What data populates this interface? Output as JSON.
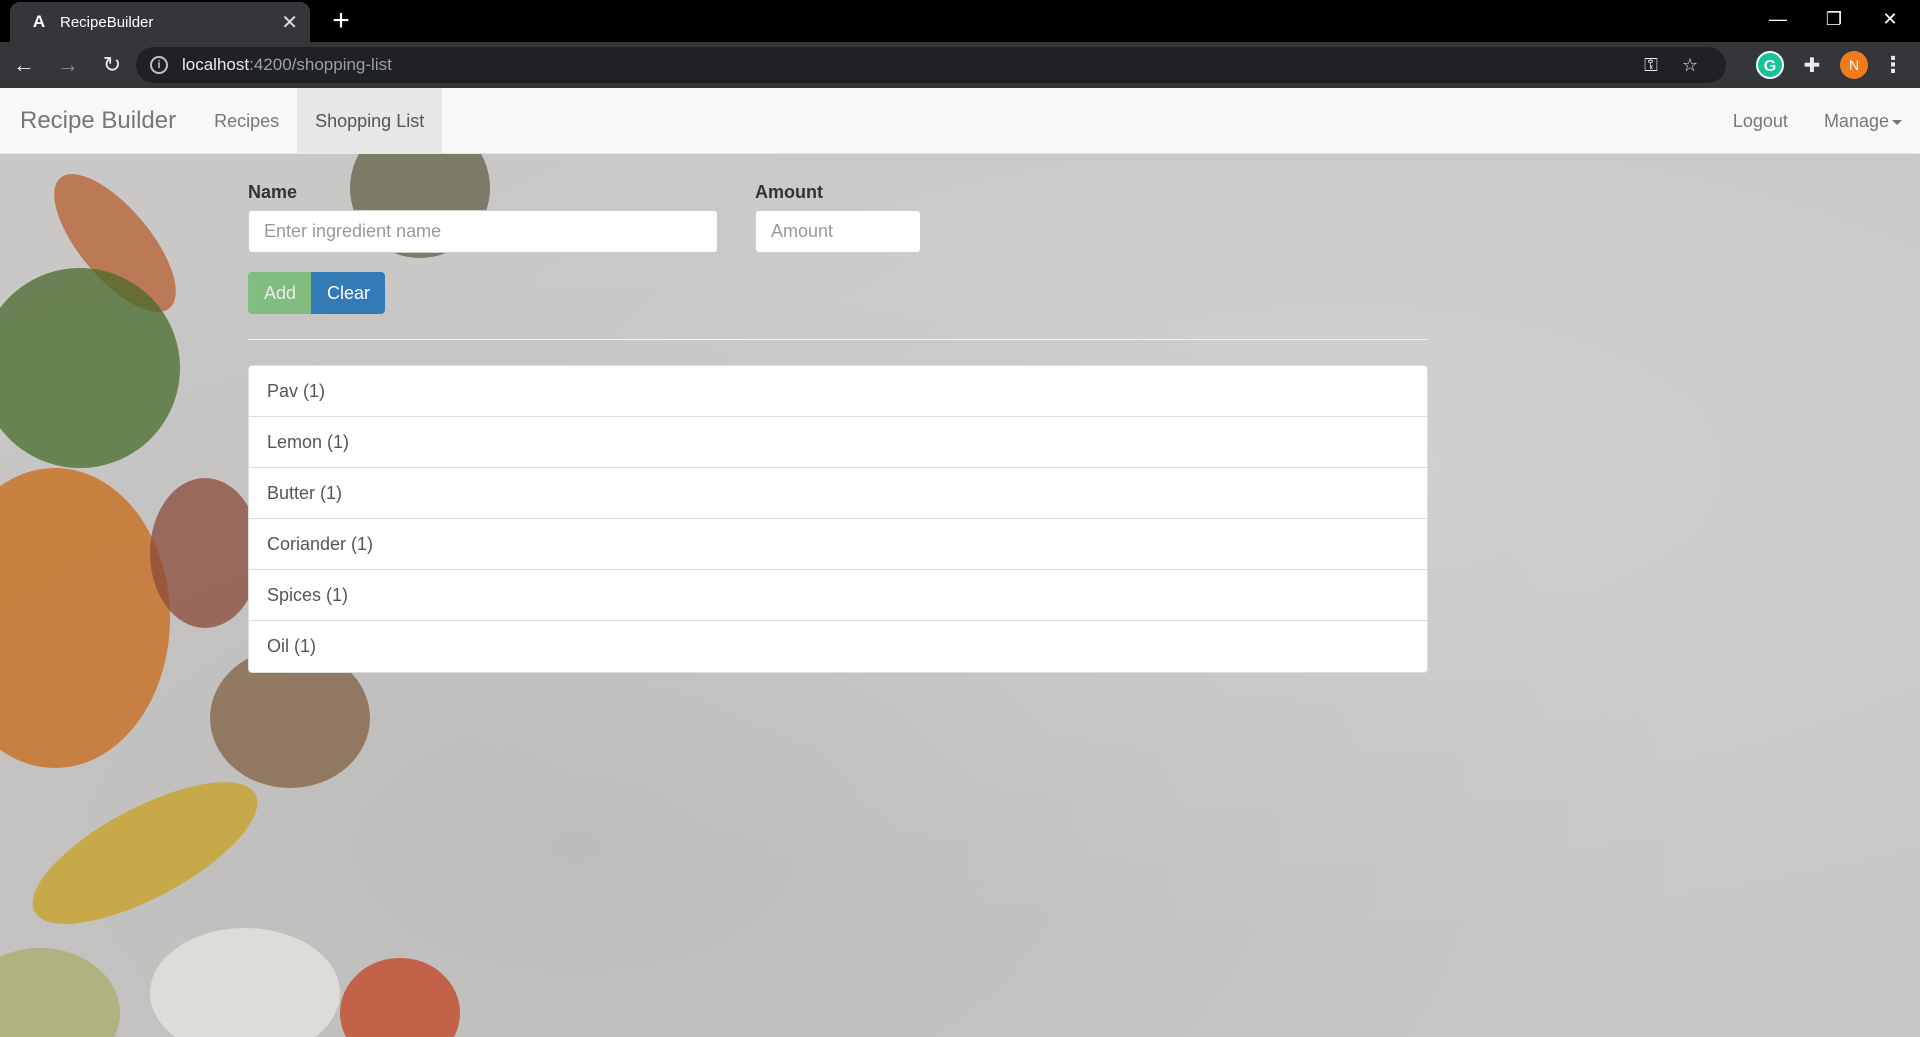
{
  "browser": {
    "tab_title": "RecipeBuilder",
    "favicon": "A",
    "url_host": "localhost",
    "url_path": ":4200/shopping-list",
    "avatar_letter": "N",
    "extension_letter": "G"
  },
  "navbar": {
    "brand": "Recipe Builder",
    "links": [
      "Recipes",
      "Shopping List"
    ],
    "active": "Shopping List",
    "logout": "Logout",
    "manage": "Manage"
  },
  "form": {
    "name_label": "Name",
    "name_placeholder": "Enter ingredient name",
    "amount_label": "Amount",
    "amount_placeholder": "Amount",
    "add_label": "Add",
    "clear_label": "Clear"
  },
  "shopping_list": [
    "Pav (1)",
    "Lemon (1)",
    "Butter (1)",
    "Coriander (1)",
    "Spices (1)",
    "Oil (1)"
  ],
  "colors": {
    "add_button": "#5cb85c",
    "clear_button": "#337ab7",
    "navbar_bg": "#f8f8f8"
  }
}
